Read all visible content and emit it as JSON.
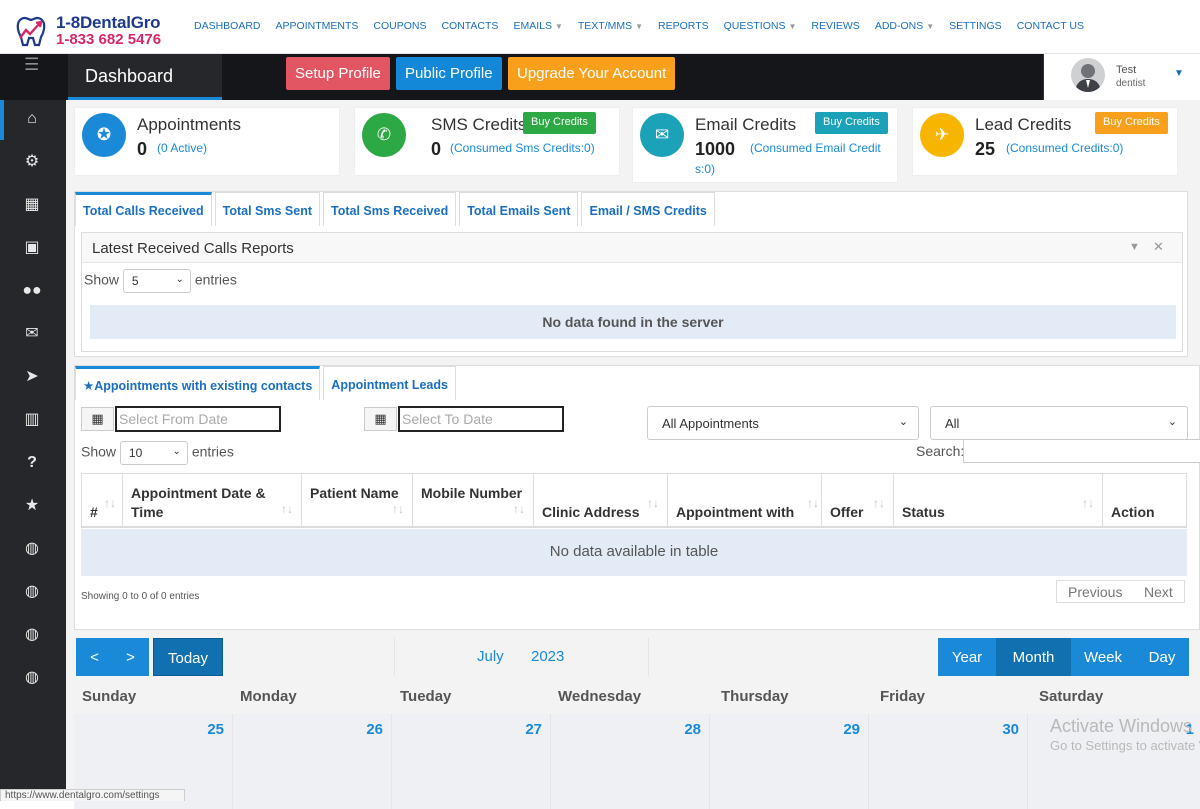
{
  "brand": {
    "name": "1-8DentalGro",
    "phone": "1-833 682 5476"
  },
  "menu": [
    {
      "label": "DASHBOARD",
      "caret": false
    },
    {
      "label": "APPOINTMENTS",
      "caret": false
    },
    {
      "label": "COUPONS",
      "caret": false
    },
    {
      "label": "CONTACTS",
      "caret": false
    },
    {
      "label": "EMAILS",
      "caret": true
    },
    {
      "label": "TEXT/MMS",
      "caret": true
    },
    {
      "label": "REPORTS",
      "caret": false
    },
    {
      "label": "QUESTIONS",
      "caret": true
    },
    {
      "label": "REVIEWS",
      "caret": false
    },
    {
      "label": "ADD-ONS",
      "caret": true
    },
    {
      "label": "SETTINGS",
      "caret": false
    },
    {
      "label": "CONTACT US",
      "caret": false
    }
  ],
  "toolbar": {
    "title": "Dashboard",
    "setup_profile": "Setup Profile",
    "public_profile": "Public Profile",
    "upgrade": "Upgrade Your Account"
  },
  "user": {
    "name": "Test",
    "role": "dentist"
  },
  "cards": {
    "appointments": {
      "title": "Appointments",
      "value": "0",
      "sub": "(0 Active)"
    },
    "sms": {
      "title": "SMS Credits",
      "value": "0",
      "sub": "(Consumed Sms Credits:0)",
      "buy": "Buy Credits"
    },
    "email": {
      "title": "Email Credits",
      "value": "1000",
      "sub1": "(Consumed Email Credit",
      "sub2": "s:0)",
      "buy": "Buy Credits"
    },
    "lead": {
      "title": "Lead Credits",
      "value": "25",
      "sub": "(Consumed Credits:0)",
      "buy": "Buy Credits"
    }
  },
  "reportTabs": [
    "Total Calls Received",
    "Total Sms Sent",
    "Total Sms Received",
    "Total Emails Sent",
    "Email / SMS Credits"
  ],
  "callsPanel": {
    "title": "Latest Received Calls Reports",
    "show": "Show",
    "entries_value": "5",
    "entries": "entries",
    "nodata": "No data found in the server"
  },
  "apptTabs": [
    "Appointments with existing contacts",
    "Appointment Leads"
  ],
  "apptPanel": {
    "from_placeholder": "Select From Date",
    "to_placeholder": "Select To Date",
    "filter1": "All Appointments",
    "filter2": "All",
    "show": "Show",
    "entries_value": "10",
    "entries": "entries",
    "search": "Search:",
    "columns": [
      "#",
      "Appointment Date & Time",
      "Patient Name",
      "Mobile Number",
      "Clinic Address",
      "Appointment with",
      "Offer",
      "Status",
      "Action"
    ],
    "nodata": "No data available in table",
    "showing": "Showing 0 to 0 of 0 entries",
    "previous": "Previous",
    "next": "Next"
  },
  "calendar": {
    "prev": "<",
    "next": ">",
    "today": "Today",
    "month": "July",
    "year": "2023",
    "views": [
      "Year",
      "Month",
      "Week",
      "Day"
    ],
    "activeView": "Month",
    "weekdays": [
      "Sunday",
      "Monday",
      "Tueday",
      "Wednesday",
      "Thursday",
      "Friday",
      "Saturday"
    ],
    "dates": [
      "25",
      "26",
      "27",
      "28",
      "29",
      "30",
      "1"
    ]
  },
  "watermark": {
    "line1": "Activate Windows",
    "line2": "Go to Settings to activate Windows."
  },
  "statusbar": "https://www.dentalgro.com/settings",
  "colors": {
    "accent": "#1a8ad8",
    "danger": "#e25563",
    "warning": "#f8a01c",
    "success": "#2ca844",
    "info": "#1ba2b8",
    "dark": "#15161a"
  }
}
